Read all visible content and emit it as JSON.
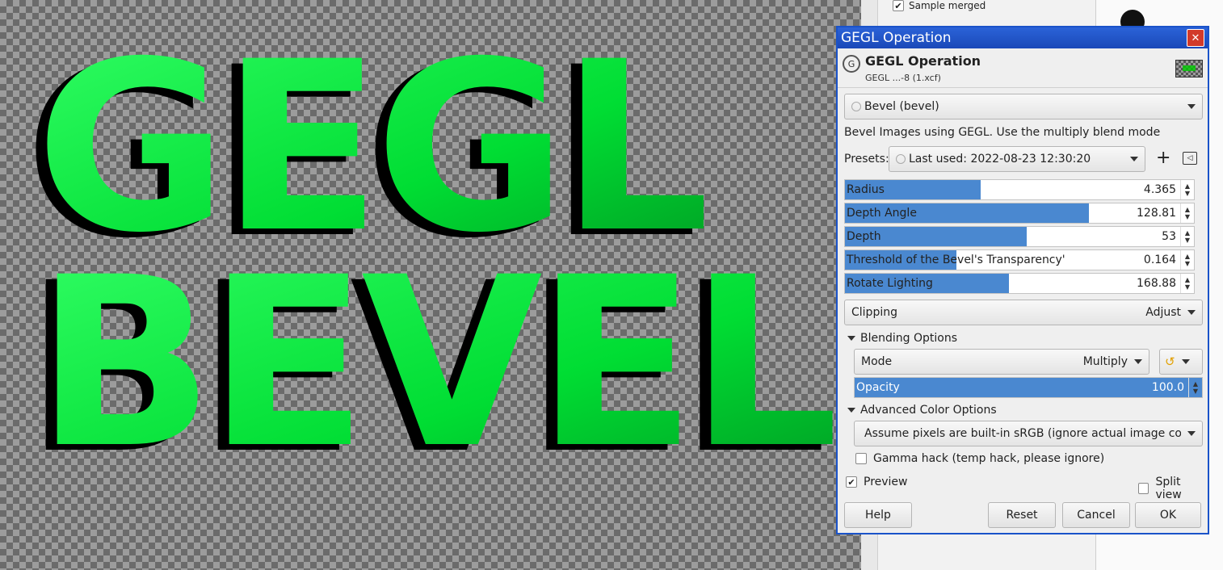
{
  "canvas": {
    "line1": "GEGL",
    "line2": "BEVEL",
    "text_color": "#00dd33",
    "shadow_color": "#000000"
  },
  "right_panel": {
    "sample_merged_label": "Sample merged",
    "sample_merged_checked": true
  },
  "dialog": {
    "window_title": "GEGL Operation",
    "header_title": "GEGL Operation",
    "header_subtitle": "GEGL ...-8 (1.xcf)",
    "operation": "Bevel (bevel)",
    "description": "Bevel Images using GEGL.  Use the multiply blend mode",
    "presets_label": "Presets:",
    "presets_value": "Last used: 2022-08-23 12:30:20",
    "params": [
      {
        "label": "Radius",
        "value": "4.365",
        "fill": 0.39
      },
      {
        "label": "Depth Angle",
        "value": "128.81",
        "fill": 0.7
      },
      {
        "label": "Depth",
        "value": "53",
        "fill": 0.52
      },
      {
        "label": "Threshold of the Bevel's Transparency'",
        "value": "0.164",
        "fill": 0.32
      },
      {
        "label": "Rotate Lighting",
        "value": "168.88",
        "fill": 0.47
      }
    ],
    "clipping_label": "Clipping",
    "clipping_value": "Adjust",
    "blending_section": "Blending Options",
    "mode_label": "Mode",
    "mode_value": "Multiply",
    "opacity_label": "Opacity",
    "opacity_value": "100.0",
    "opacity_fill": 1.0,
    "advanced_section": "Advanced Color Options",
    "color_space": "Assume pixels are built-in sRGB (ignore actual image color space)",
    "gamma_label": "Gamma hack (temp hack, please ignore)",
    "gamma_checked": false,
    "preview_label": "Preview",
    "preview_checked": true,
    "split_label": "Split view",
    "split_checked": false,
    "buttons": {
      "help": "Help",
      "reset": "Reset",
      "cancel": "Cancel",
      "ok": "OK"
    }
  }
}
